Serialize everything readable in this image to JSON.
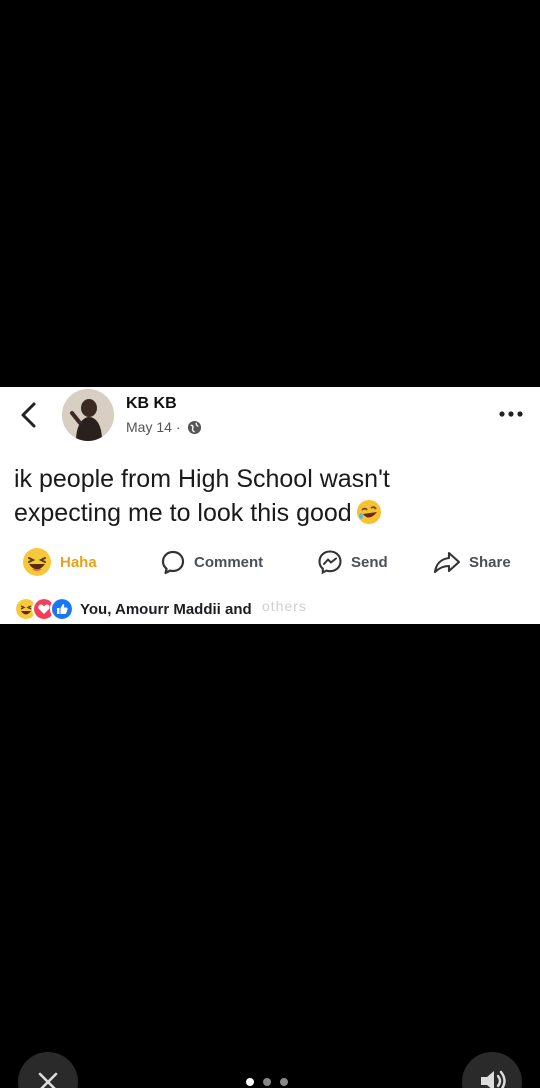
{
  "post": {
    "author": "KB KB",
    "date": "May 14",
    "separator": "·",
    "text_line1": "ik people from High School wasn't",
    "text_line2": "expecting me to look this good",
    "text_emoji": "rofl-emoji"
  },
  "actions": {
    "haha": "Haha",
    "comment": "Comment",
    "send": "Send",
    "share": "Share"
  },
  "reactions": {
    "summary": "You, Amourr Maddii and",
    "overlay_text": "others"
  },
  "colors": {
    "haha": "#e8a21b",
    "like": "#1877f2",
    "love": "#f33e58"
  },
  "pager": {
    "count": 3,
    "active": 1
  }
}
